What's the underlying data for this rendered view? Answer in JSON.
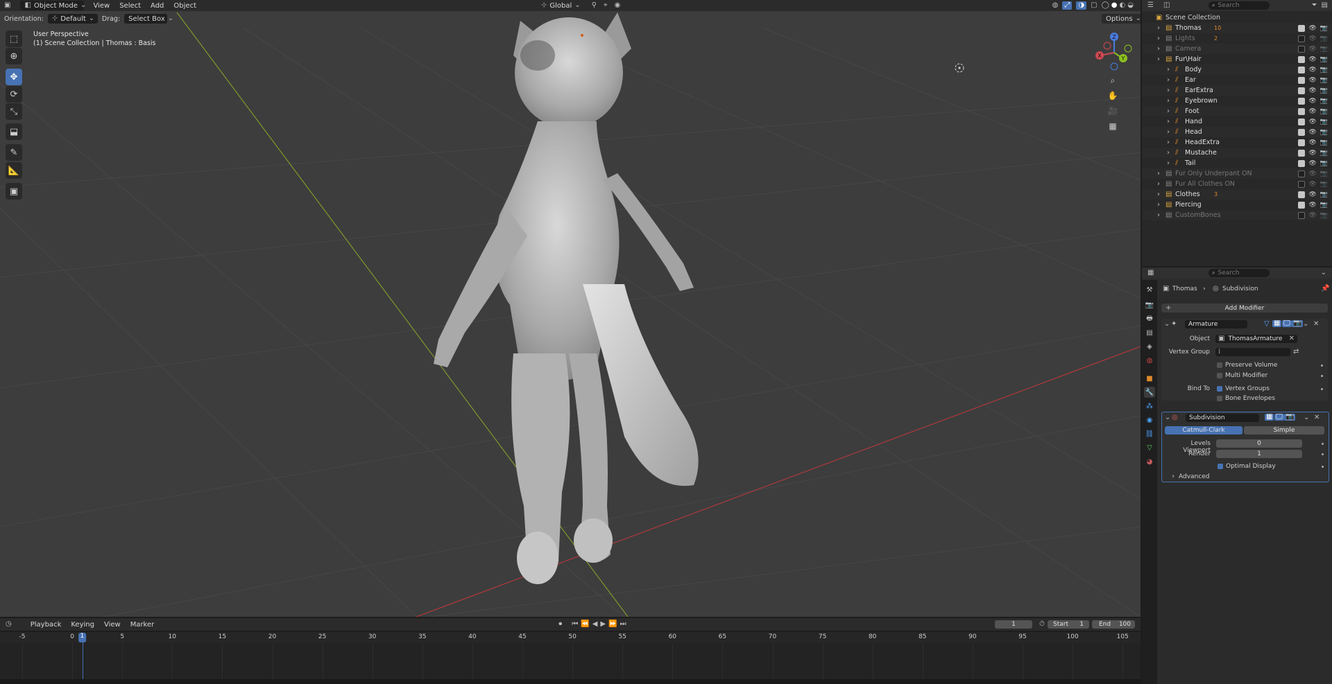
{
  "viewport": {
    "mode": "Object Mode",
    "menus": [
      "View",
      "Select",
      "Add",
      "Object"
    ],
    "transform_orientation": "Global",
    "options_label": "Options",
    "orientation_label": "Orientation:",
    "orientation_value": "Default",
    "drag_label": "Drag:",
    "drag_value": "Select Box",
    "overlay_title": "User Perspective",
    "overlay_sub": "(1) Scene Collection | Thomas : Basis",
    "gizmo": {
      "x": "X",
      "y": "Y",
      "z": "Z"
    }
  },
  "outliner": {
    "search_placeholder": "Search",
    "rows": [
      {
        "name": "Scene Collection",
        "indent": 0,
        "color": "#d0d0d0"
      },
      {
        "name": "Thomas",
        "indent": 1,
        "color": "#e0e0e0",
        "tail": "10"
      },
      {
        "name": "Lights",
        "indent": 1,
        "color": "#777777",
        "tail": "2"
      },
      {
        "name": "Camera",
        "indent": 1,
        "color": "#777777"
      },
      {
        "name": "Fur\\Hair",
        "indent": 1,
        "color": "#e0e0e0"
      },
      {
        "name": "Body",
        "indent": 2,
        "color": "#e0e0e0"
      },
      {
        "name": "Ear",
        "indent": 2,
        "color": "#e0e0e0"
      },
      {
        "name": "EarExtra",
        "indent": 2,
        "color": "#e0e0e0"
      },
      {
        "name": "Eyebrown",
        "indent": 2,
        "color": "#e0e0e0"
      },
      {
        "name": "Foot",
        "indent": 2,
        "color": "#e0e0e0"
      },
      {
        "name": "Hand",
        "indent": 2,
        "color": "#e0e0e0"
      },
      {
        "name": "Head",
        "indent": 2,
        "color": "#e0e0e0"
      },
      {
        "name": "HeadExtra",
        "indent": 2,
        "color": "#e0e0e0"
      },
      {
        "name": "Mustache",
        "indent": 2,
        "color": "#e0e0e0"
      },
      {
        "name": "Tail",
        "indent": 2,
        "color": "#e0e0e0"
      },
      {
        "name": "Fur Only Underpant ON",
        "indent": 1,
        "color": "#777777"
      },
      {
        "name": "Fur All Clothes ON",
        "indent": 1,
        "color": "#777777"
      },
      {
        "name": "Clothes",
        "indent": 1,
        "color": "#e0e0e0",
        "tail": "3"
      },
      {
        "name": "Piercing",
        "indent": 1,
        "color": "#e0e0e0"
      },
      {
        "name": "CustomBones",
        "indent": 1,
        "color": "#777777"
      }
    ]
  },
  "properties": {
    "search_placeholder": "Search",
    "breadcrumb_object": "Thomas",
    "breadcrumb_modifier": "Subdivision",
    "add_modifier": "Add Modifier",
    "armature": {
      "name": "Armature",
      "object_label": "Object",
      "object_value": "ThomasArmature",
      "vertex_group_label": "Vertex Group",
      "preserve_volume": "Preserve Volume",
      "multi_modifier": "Multi Modifier",
      "bind_to_label": "Bind To",
      "vertex_groups": "Vertex Groups",
      "bone_envelopes": "Bone Envelopes"
    },
    "subdivision": {
      "name": "Subdivision",
      "catmull": "Catmull-Clark",
      "simple": "Simple",
      "levels_viewport_label": "Levels Viewport",
      "levels_viewport_value": "0",
      "render_label": "Render",
      "render_value": "1",
      "optimal_display": "Optimal Display",
      "advanced": "Advanced"
    }
  },
  "timeline": {
    "menus": [
      "Playback",
      "Keying",
      "View",
      "Marker"
    ],
    "current_frame": "1",
    "start_label": "Start",
    "start_value": "1",
    "end_label": "End",
    "end_value": "100",
    "ticks": [
      "-5",
      "0",
      "5",
      "10",
      "15",
      "20",
      "25",
      "30",
      "35",
      "40",
      "45",
      "50",
      "55",
      "60",
      "65",
      "70",
      "75",
      "80",
      "85",
      "90",
      "95",
      "100",
      "105"
    ],
    "playhead": "1"
  }
}
